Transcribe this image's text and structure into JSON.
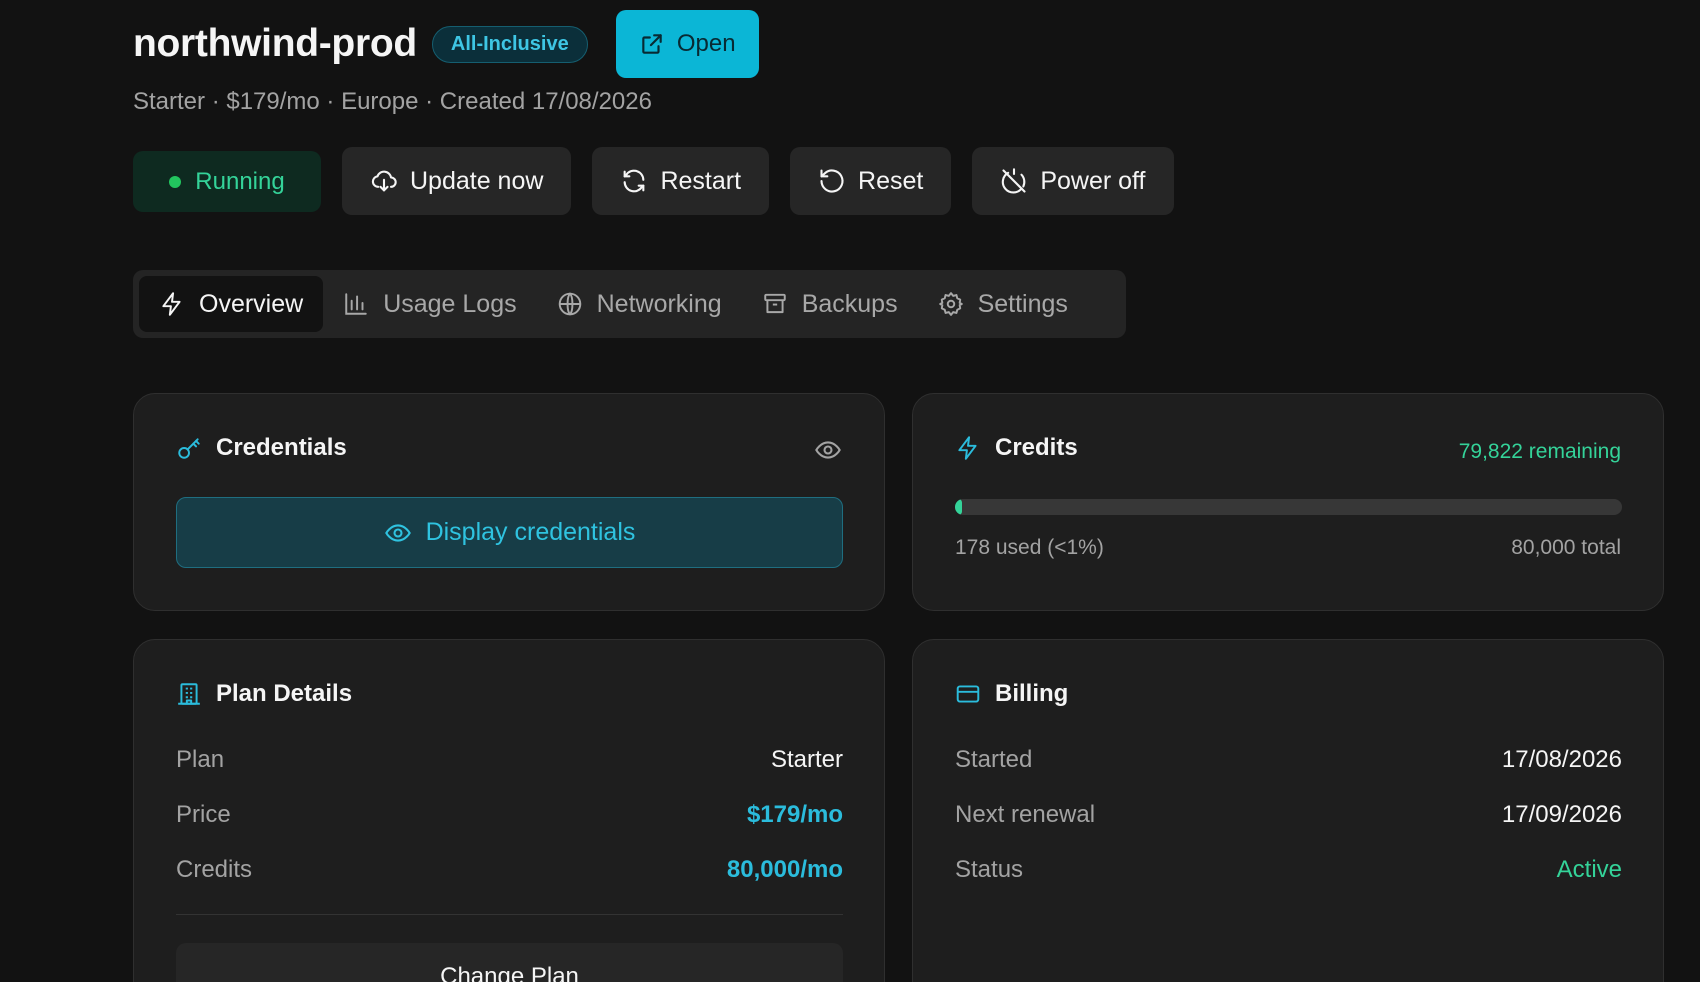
{
  "header": {
    "title": "northwind-prod",
    "badge": "All-Inclusive",
    "open_label": "Open",
    "subtitle": "Starter · $179/mo · Europe · Created 17/08/2026"
  },
  "actions": {
    "status": "Running",
    "update_label": "Update now",
    "restart_label": "Restart",
    "reset_label": "Reset",
    "power_off_label": "Power off"
  },
  "tabs": [
    {
      "label": "Overview",
      "icon": "lightning-icon",
      "active": true
    },
    {
      "label": "Usage Logs",
      "icon": "bar-chart-icon",
      "active": false
    },
    {
      "label": "Networking",
      "icon": "globe-icon",
      "active": false
    },
    {
      "label": "Backups",
      "icon": "archive-icon",
      "active": false
    },
    {
      "label": "Settings",
      "icon": "gear-icon",
      "active": false
    }
  ],
  "credentials": {
    "title": "Credentials",
    "display_label": "Display credentials"
  },
  "credits": {
    "title": "Credits",
    "remaining": "79,822 remaining",
    "used": "178 used (<1%)",
    "total": "80,000 total",
    "used_fraction": 0.0022
  },
  "plan": {
    "title": "Plan Details",
    "rows": [
      {
        "label": "Plan",
        "value": "Starter"
      },
      {
        "label": "Price",
        "value": "$179/mo"
      },
      {
        "label": "Credits",
        "value": "80,000/mo"
      }
    ],
    "change_label": "Change Plan"
  },
  "billing": {
    "title": "Billing",
    "rows": [
      {
        "label": "Started",
        "value": "17/08/2026"
      },
      {
        "label": "Next renewal",
        "value": "17/09/2026"
      },
      {
        "label": "Status",
        "value": "Active"
      }
    ]
  },
  "colors": {
    "accent": "#0bb6d6",
    "success": "#34d399",
    "background": "#121212",
    "card": "#1e1e1e"
  }
}
